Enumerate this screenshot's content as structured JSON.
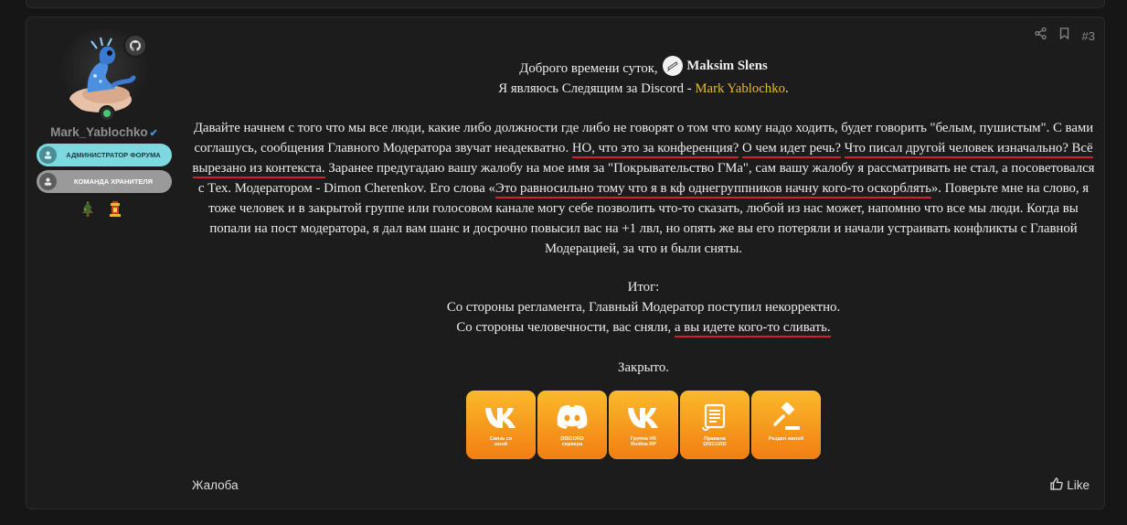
{
  "user": {
    "name": "Mark_Yablochko",
    "banners": [
      "АДМИНИСТРАТОР ФОРУМА",
      "КОМАНДА ХРАНИТЕЛЯ"
    ]
  },
  "post": {
    "number": "#3",
    "greeting_prefix": "Доброго времени суток,",
    "mention": "Maksim Slens",
    "follower_line_prefix": "Я являюсь Следящим за Discord -",
    "follower_name": "Mark Yablochko",
    "follower_suffix": ".",
    "p1": {
      "a": "Давайте начнем с того что мы все люди, какие либо должности где либо не говорят о том что кому надо ходить, будет говорить \"белым, пушистым\". С вами соглашусь, сообщения Главного Модератора звучат неадекватно.",
      "b": "НО, что это за конференция?",
      "c": "О чем идет речь?",
      "d": "Что писал другой человек изначально? Всё вырезано из контекста.",
      "e": "Заранее предугадаю вашу жалобу на мое имя за \"Покрывательство ГМа\", сам вашу жалобу я рассматривать не стал, а посоветовался с Тех. Модератором - Dimon Cherenkov. Его слова «",
      "f": "Это равносильно тому что я в кф однегруппников начну кого-то оскорблять",
      "g": "». Поверьте мне на слово, я тоже человек и в закрытой группе или голосовом канале могу себе позволить что-то сказать, любой из нас может, напомню что все мы люди. Когда вы попали на пост модератора, я дал вам шанс и досрочно повысил вас на +1 лвл, но опять же вы его потеряли и начали устраивать конфликты с Главной Модерацией, за что и были сняты."
    },
    "summary_title": "Итог:",
    "summary_1": "Со стороны регламента, Главный Модератор поступил некорректно.",
    "summary_2_a": "Со стороны человечности, вас сняли,",
    "summary_2_b": "а вы идете кого-то сливать.",
    "closed": "Закрыто.",
    "buttons": [
      {
        "icon": "vk-icon",
        "label": "Связь со\nмной"
      },
      {
        "icon": "discord-icon",
        "label": "DISCORD\nсервера"
      },
      {
        "icon": "vk-icon",
        "label": "Группа VK\nRodina RP"
      },
      {
        "icon": "scroll-icon",
        "label": "Правила\nDISCORD"
      },
      {
        "icon": "gavel-icon",
        "label": "Раздел жалоб"
      }
    ],
    "complaint_label": "Жалоба",
    "like_label": "Like"
  },
  "colors": {
    "accent": "#e5b73b",
    "underline": "#d1212d",
    "button_top": "#fbb92c",
    "button_bottom": "#f27e12"
  }
}
